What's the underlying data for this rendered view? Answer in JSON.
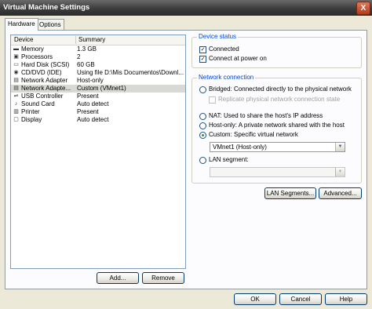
{
  "window": {
    "title": "Virtual Machine Settings",
    "close_glyph": "X"
  },
  "tabs": [
    {
      "label": "Hardware"
    },
    {
      "label": "Options"
    }
  ],
  "device_list": {
    "headers": {
      "device": "Device",
      "summary": "Summary"
    },
    "rows": [
      {
        "icon": "memory-icon",
        "name": "Memory",
        "summary": "1.3 GB"
      },
      {
        "icon": "processor-icon",
        "name": "Processors",
        "summary": "2"
      },
      {
        "icon": "hard-disk-icon",
        "name": "Hard Disk (SCSI)",
        "summary": "60 GB"
      },
      {
        "icon": "cd-dvd-icon",
        "name": "CD/DVD (IDE)",
        "summary": "Using file D:\\Mis Documentos\\Downl..."
      },
      {
        "icon": "network-adapter-icon",
        "name": "Network Adapter",
        "summary": "Host-only"
      },
      {
        "icon": "network-adapter-icon",
        "name": "Network Adapte...",
        "summary": "Custom (VMnet1)"
      },
      {
        "icon": "usb-icon",
        "name": "USB Controller",
        "summary": "Present"
      },
      {
        "icon": "sound-card-icon",
        "name": "Sound Card",
        "summary": "Auto detect"
      },
      {
        "icon": "printer-icon",
        "name": "Printer",
        "summary": "Present"
      },
      {
        "icon": "display-icon",
        "name": "Display",
        "summary": "Auto detect"
      }
    ],
    "selected_index": 5,
    "add_label": "Add...",
    "remove_label": "Remove"
  },
  "device_status": {
    "title": "Device status",
    "connected": {
      "label": "Connected",
      "checked": true
    },
    "connect_at_power_on": {
      "label": "Connect at power on",
      "checked": true
    }
  },
  "network_connection": {
    "title": "Network connection",
    "bridged": "Bridged: Connected directly to the physical network",
    "replicate": "Replicate physical network connection state",
    "nat": "NAT: Used to share the host's IP address",
    "host_only": "Host-only: A private network shared with the host",
    "custom": "Custom: Specific virtual network",
    "custom_value": "VMnet1 (Host-only)",
    "lan_segment": "LAN segment:",
    "lan_segment_value": "",
    "selected": "custom"
  },
  "buttons": {
    "lan_segments": "LAN Segments...",
    "advanced": "Advanced...",
    "ok": "OK",
    "cancel": "Cancel",
    "help": "Help"
  }
}
